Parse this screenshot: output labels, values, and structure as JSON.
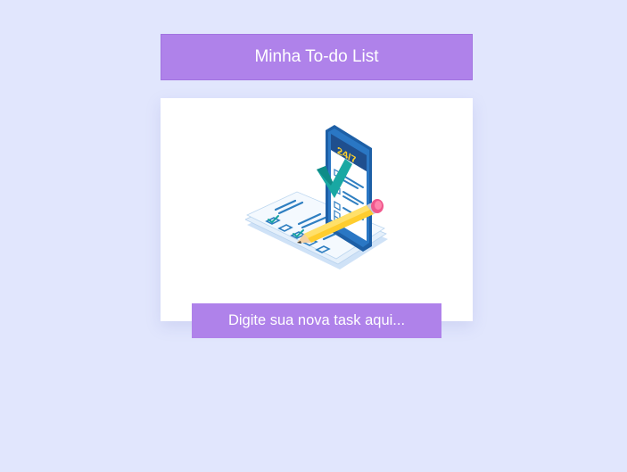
{
  "header": {
    "title": "Minha To-do List"
  },
  "illustration": {
    "icon": "checklist-phone-pencil-icon",
    "phone_badge": "24/7"
  },
  "task_input": {
    "value": "",
    "placeholder": "Digite sua nova task aqui..."
  },
  "colors": {
    "background": "#e1e6fd",
    "accent": "#af82ea",
    "card": "#ffffff"
  }
}
